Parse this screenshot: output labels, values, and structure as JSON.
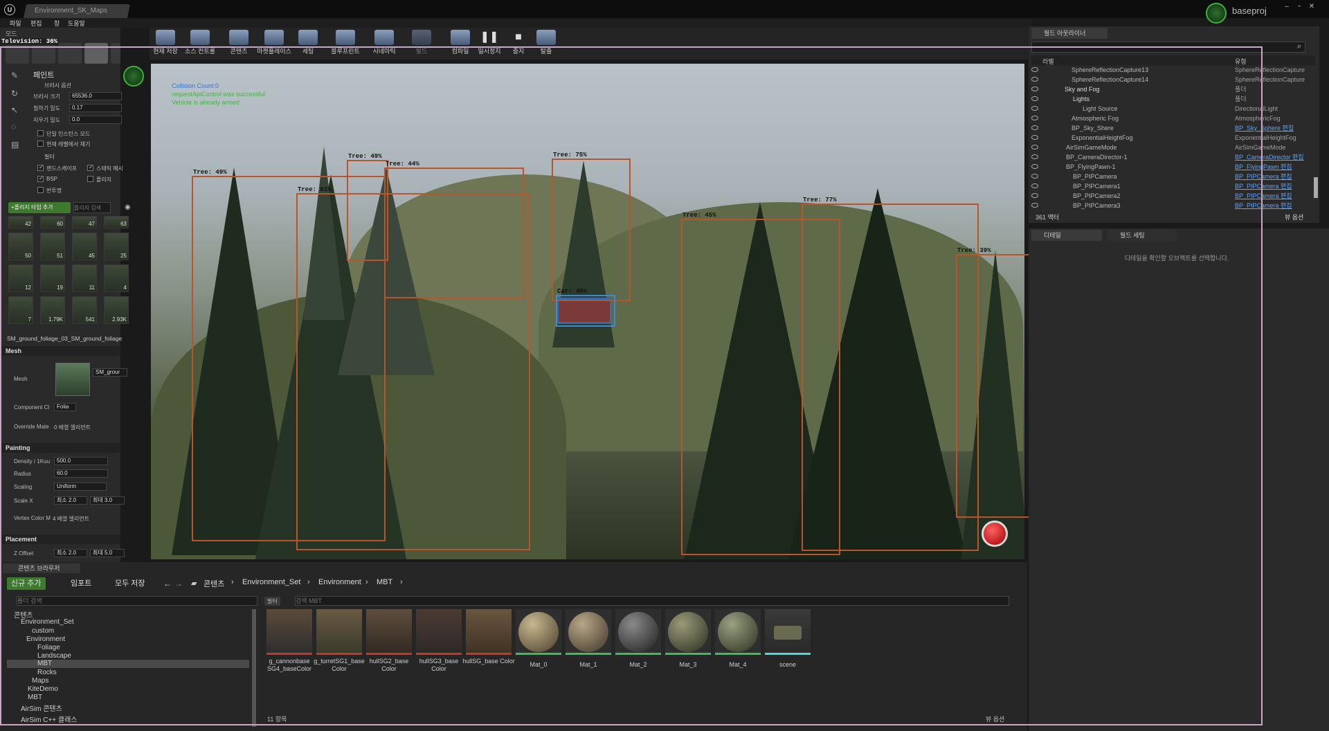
{
  "window": {
    "tab_title": "Environment_SK_Maps",
    "project_name": "baseproj"
  },
  "menu": [
    "파일",
    "편집",
    "창",
    "도움말"
  ],
  "left_panel": {
    "title": "모드",
    "television_label": "Television: 36%",
    "mode_header": "페인트",
    "brush_options_label": "브러시 옵션",
    "brush_size_label": "브러시 크기",
    "brush_size_value": "65536.0",
    "paint_density_label": "칠하기 밀도",
    "paint_density_value": "0.17",
    "erase_density_label": "지우기 밀도",
    "erase_density_value": "0.0",
    "single_instance": "단일 인스턴스 모드",
    "current_level": "현재 레벨에서 채기",
    "filter_label": "필터",
    "filters": [
      {
        "label": "랜드스케이프",
        "checked": true
      },
      {
        "label": "스태틱 메시",
        "checked": true
      },
      {
        "label": "BSP",
        "checked": true
      },
      {
        "label": "폴리지",
        "checked": false
      },
      {
        "label": "반투명",
        "checked": false
      }
    ],
    "add_foliage_label": "+폴리지 타입 추가",
    "foliage_search_placeholder": "폴리지 검색",
    "thumbs_row0": [
      "42",
      "60",
      "47",
      "63"
    ],
    "thumbs_row1": [
      "50",
      "51",
      "45",
      "25"
    ],
    "thumbs_row2": [
      "12",
      "19",
      "11",
      "4"
    ],
    "thumbs_row3": [
      "7",
      "1.79K",
      "541",
      "2.93K"
    ],
    "selected_asset": "SM_ground_foliage_03_SM_ground_foliage",
    "mesh_section": "Mesh",
    "mesh_label": "Mesh",
    "mesh_dropdown": "SM_grour",
    "component_label": "Component Cl",
    "component_value": "Folia",
    "override_label": "Override Mate",
    "override_value": "0 배열 엘리먼트",
    "painting_section": "Painting",
    "density_label": "Density / 1Kuu",
    "density_value": "500.0",
    "radius_label": "Radius",
    "radius_value": "60.0",
    "scaling_label": "Scaling",
    "scaling_value": "Uniform",
    "scalex_label": "Scale X",
    "scalex_min": "최소 2.0",
    "scalex_max": "최대 3.0",
    "vertex_color_label": "Vertex Color M",
    "vertex_color_value": "4 배열 엘리먼트",
    "placement_section": "Placement",
    "zoffset_label": "Z Offset",
    "zoffset_min": "최소 2.0",
    "zoffset_max": "최대 5.0"
  },
  "toolbar": {
    "buttons": [
      "현재 저장",
      "소스 컨트롤",
      "콘텐츠",
      "마켓플레이스",
      "세팅",
      "블루프린트",
      "시네마틱",
      "빌드",
      "컴파일",
      "일시정지",
      "중지",
      "탈출"
    ]
  },
  "viewport": {
    "messages": [
      "Collision Count:0",
      "requestApiControl was successful",
      "Vehicle is already armed"
    ],
    "detections": [
      {
        "label": "Tree: 49%",
        "type": "tree"
      },
      {
        "label": "Tree: 61%",
        "type": "tree"
      },
      {
        "label": "Tree: 49%",
        "type": "tree"
      },
      {
        "label": "Tree: 44%",
        "type": "tree"
      },
      {
        "label": "Tree: 75%",
        "type": "tree"
      },
      {
        "label": "Car: 49%",
        "type": "car"
      },
      {
        "label": "Tree: 45%",
        "type": "tree"
      },
      {
        "label": "Tree: 77%",
        "type": "tree"
      },
      {
        "label": "Tree: 39%",
        "type": "tree"
      }
    ]
  },
  "outliner": {
    "tab": "월드 아웃라이너",
    "col_label": "라벨",
    "col_type": "유형",
    "rows": [
      {
        "label": "SphereReflectionCapture13",
        "type": "SphereReflectionCapture",
        "link": false
      },
      {
        "label": "SphereReflectionCapture14",
        "type": "SphereReflectionCapture",
        "link": false
      },
      {
        "label": "Sky and Fog",
        "type": "폴더",
        "link": false
      },
      {
        "label": "Lights",
        "type": "폴더",
        "link": false
      },
      {
        "label": "Light Source",
        "type": "DirectionalLight",
        "link": false
      },
      {
        "label": "Atmospheric Fog",
        "type": "AtmosphericFog",
        "link": false
      },
      {
        "label": "BP_Sky_Shere",
        "type": "BP_Sky_Sphere 편집",
        "link": true
      },
      {
        "label": "ExponentialHeightFog",
        "type": "ExponentialHeightFog",
        "link": false
      },
      {
        "label": "AirSimGameMode",
        "type": "AirSimGameMode",
        "link": false
      },
      {
        "label": "BP_CameraDirector-1",
        "type": "BP_CameraDirector 편집",
        "link": true
      },
      {
        "label": "BP_FlyingPawn-1",
        "type": "BP_FlyingPawn 편집",
        "link": true
      },
      {
        "label": "BP_PIPCamera",
        "type": "BP_PIPCamera 편집",
        "link": true
      },
      {
        "label": "BP_PIPCamera1",
        "type": "BP_PIPCamera 편집",
        "link": true
      },
      {
        "label": "BP_PIPCamera2",
        "type": "BP_PIPCamera 편집",
        "link": true
      },
      {
        "label": "BP_PIPCamera3",
        "type": "BP_PIPCamera 편집",
        "link": true
      }
    ],
    "actor_count": "361 액터",
    "view_options": "뷰 옵션"
  },
  "details": {
    "tab_details": "디테일",
    "tab_world": "월드 세팅",
    "empty_msg": "디테일을 확인할 오브젝트를 선택합니다."
  },
  "content_browser": {
    "tab": "콘텐츠 브라우저",
    "add_new": "신규 추가",
    "import": "임포트",
    "save_all": "모두 저장",
    "breadcrumb": [
      "콘텐츠",
      "Environment_Set",
      "Environment",
      "MBT"
    ],
    "folder_search_placeholder": "폴더 검색",
    "filter_label": "필터",
    "asset_search_placeholder": "검색 MBT",
    "tree": [
      "콘텐츠",
      "Environment_Set",
      "custom",
      "Environment",
      "Foliage",
      "Landscape",
      "MBT",
      "Rocks",
      "Maps",
      "KiteDemo",
      "MBT",
      "AirSim 콘텐츠",
      "AirSim C++ 클래스"
    ],
    "assets": [
      {
        "name": "g_cannonbase SG4_baseColor",
        "kind": "texture"
      },
      {
        "name": "g_turretSG1_base Color",
        "kind": "texture"
      },
      {
        "name": "hullSG2_base Color",
        "kind": "texture"
      },
      {
        "name": "hullSG3_base Color",
        "kind": "texture"
      },
      {
        "name": "hullSG_base Color",
        "kind": "texture"
      },
      {
        "name": "Mat_0",
        "kind": "material"
      },
      {
        "name": "Mat_1",
        "kind": "material"
      },
      {
        "name": "Mat_2",
        "kind": "material"
      },
      {
        "name": "Mat_3",
        "kind": "material"
      },
      {
        "name": "Mat_4",
        "kind": "material"
      },
      {
        "name": "scene",
        "kind": "mesh"
      }
    ],
    "item_count": "11 항목",
    "view_options": "뷰 옵션"
  }
}
